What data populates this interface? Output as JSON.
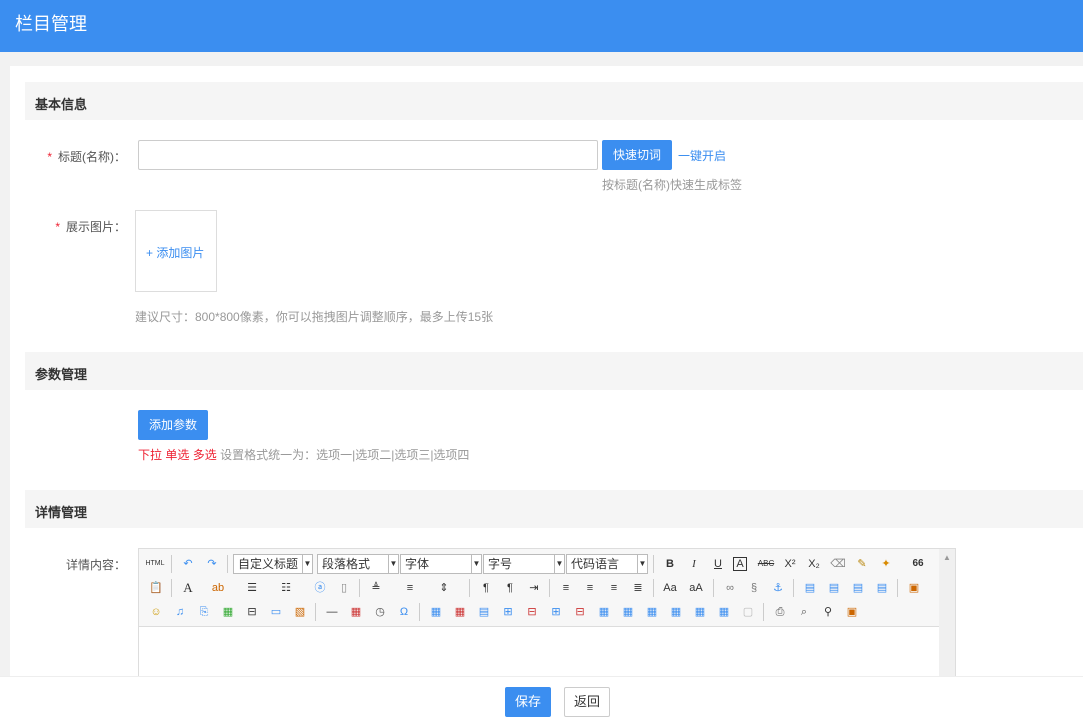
{
  "header": {
    "title": "栏目管理"
  },
  "sections": {
    "basic": "基本信息",
    "params": "参数管理",
    "detail": "详情管理"
  },
  "form": {
    "title_label": "标题(名称)：",
    "required_mark": "*",
    "quick_cut_button": "快速切词",
    "one_key_link": "一键开启",
    "title_hint": "按标题(名称)快速生成标签",
    "image_label": "展示图片：",
    "add_image": "+ 添加图片",
    "image_hint": "建议尺寸：800*800像素，你可以拖拽图片调整顺序，最多上传15张",
    "add_param_button": "添加参数",
    "param_types": [
      "下拉",
      "单选",
      "多选"
    ],
    "param_hint": "设置格式统一为：选项一|选项二|选项三|选项四",
    "detail_label": "详情内容："
  },
  "editor": {
    "html_label": "HTML",
    "selects": [
      "自定义标题",
      "段落格式",
      "字体",
      "字号",
      "代码语言"
    ],
    "icons_row1": [
      "undo-icon",
      "redo-icon",
      "bold-icon",
      "italic-icon",
      "underline-icon",
      "font-border-icon",
      "strikethrough-icon",
      "superscript-icon",
      "subscript-icon",
      "eraser-icon",
      "format-brush-icon",
      "auto-format-icon",
      "blockquote-icon"
    ],
    "icons_row2": [
      "paste-icon",
      "font-color-icon",
      "highlight-icon",
      "ordered-list-icon",
      "unordered-list-icon",
      "select-all-icon",
      "clear-doc-icon",
      "line-height-icon",
      "para-spacing-icon",
      "row-spacing-icon",
      "ltr-icon",
      "rtl-icon",
      "indent-icon",
      "align-left-icon",
      "align-center-icon",
      "align-right-icon",
      "justify-icon",
      "uppercase-icon",
      "lowercase-icon",
      "link-icon",
      "unlink-icon",
      "anchor-icon",
      "img-left-icon",
      "img-none-icon",
      "img-right-icon",
      "img-center-icon",
      "image-icon"
    ],
    "icons_row3": [
      "emotion-icon",
      "music-icon",
      "attachment-icon",
      "map-icon",
      "page-break-icon",
      "template-icon",
      "background-icon",
      "horizontal-rule-icon",
      "date-icon",
      "time-icon",
      "special-char-icon",
      "table-icon",
      "delete-table-icon",
      "insert-caption-icon",
      "insert-row-icon",
      "delete-row-icon",
      "insert-col-icon",
      "delete-col-icon",
      "merge-cells-icon",
      "merge-right-icon",
      "merge-down-icon",
      "split-cells-icon",
      "split-rows-icon",
      "split-cols-icon",
      "chart-icon",
      "print-icon",
      "preview-icon",
      "search-replace-icon",
      "draft-icon"
    ],
    "glyphs": {
      "bold": "B",
      "italic": "I",
      "underline": "U",
      "border": "A",
      "strike": "ABC",
      "sup": "X²",
      "sub": "X₂",
      "omega": "Ω",
      "quote": "66"
    }
  },
  "footer": {
    "save": "保存",
    "back": "返回"
  },
  "colors": {
    "primary": "#3b8ef0",
    "required": "#ee2233"
  }
}
